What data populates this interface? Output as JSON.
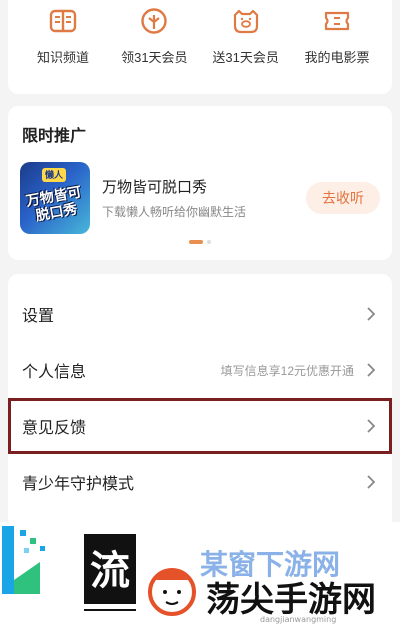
{
  "quick_actions": [
    {
      "label": "知识频道",
      "icon": "book-icon"
    },
    {
      "label": "领31天会员",
      "icon": "vip-tree-icon"
    },
    {
      "label": "送31天会员",
      "icon": "gift-pig-icon"
    },
    {
      "label": "我的电影票",
      "icon": "ticket-icon"
    }
  ],
  "promo": {
    "title": "限时推广",
    "cover_text": "万物皆可脱口秀",
    "cover_badge": "懒人",
    "name": "万物皆可脱口秀",
    "desc": "下载懒人畅听给你幽默生活",
    "button": "去收听"
  },
  "settings": [
    {
      "label": "设置",
      "hint": ""
    },
    {
      "label": "个人信息",
      "hint": "填写信息享12元优惠开通"
    },
    {
      "label": "意见反馈",
      "hint": ""
    },
    {
      "label": "青少年守护模式",
      "hint": ""
    }
  ],
  "watermark": {
    "char": "流",
    "brand": "荡尖手游网",
    "url": "dangjianwangming",
    "faint": "某窗下游网"
  },
  "colors": {
    "accent": "#e2733d",
    "highlight_border": "#7a1f1f"
  }
}
